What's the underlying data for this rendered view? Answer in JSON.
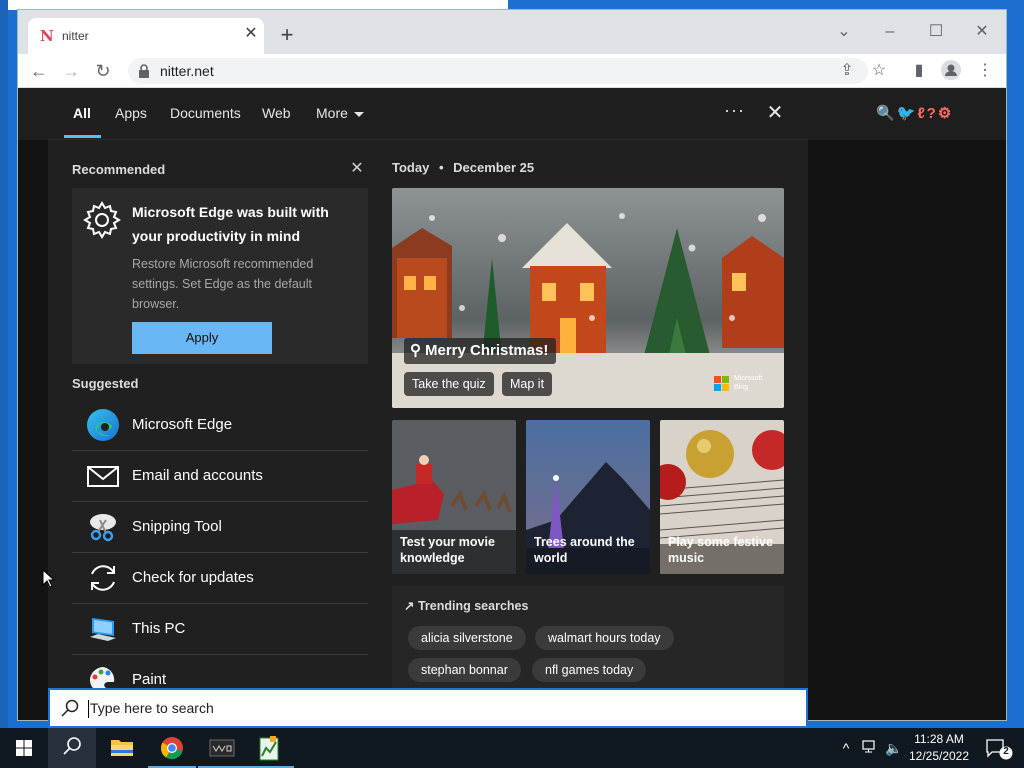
{
  "browser": {
    "tab_title": "nitter",
    "tab_favicon": "N",
    "tab_close": "✕",
    "new_tab": "+",
    "url": "nitter.net"
  },
  "nitter_toolbar_icons": "🔍🐦ℓ?⚙",
  "search_panel": {
    "tabs": [
      {
        "label": "All",
        "active": true
      },
      {
        "label": "Apps"
      },
      {
        "label": "Documents"
      },
      {
        "label": "Web"
      },
      {
        "label": "More"
      }
    ],
    "more_options": "···",
    "recommended_label": "Recommended",
    "recommended_card": {
      "title": "Microsoft Edge was built with your productivity in mind",
      "body": "Restore Microsoft recommended settings. Set Edge as the default browser.",
      "button": "Apply"
    },
    "suggested_label": "Suggested",
    "suggested": [
      {
        "label": "Microsoft Edge",
        "icon": "edge-icon"
      },
      {
        "label": "Email and accounts",
        "icon": "mail-icon"
      },
      {
        "label": "Snipping Tool",
        "icon": "scissors-icon"
      },
      {
        "label": "Check for updates",
        "icon": "sync-icon"
      },
      {
        "label": "This PC",
        "icon": "computer-icon"
      },
      {
        "label": "Paint",
        "icon": "palette-icon"
      }
    ],
    "today": {
      "label": "Today",
      "separator": "•",
      "date": "December 25"
    },
    "hero": {
      "title": "Merry Christmas!",
      "buttons": [
        "Take the quiz",
        "Map it"
      ],
      "badge": "Microsoft Bing"
    },
    "tiles": [
      {
        "label": "Test your movie knowledge"
      },
      {
        "label": "Trees around the world"
      },
      {
        "label": "Play some festive music"
      }
    ],
    "trending": {
      "title": "Trending searches",
      "items": [
        "alicia silverstone",
        "walmart hours today",
        "stephan bonnar",
        "nfl games today"
      ]
    }
  },
  "searchbox": {
    "placeholder": "Type here to search"
  },
  "taskbar": {
    "time": "11:28 AM",
    "date": "12/25/2022",
    "notification_count": "2"
  },
  "colors": {
    "accent": "#4cc2ff",
    "apply_button": "#69b7f5",
    "nitter_accent": "#ff6c60",
    "panel_bg": "#202020"
  }
}
